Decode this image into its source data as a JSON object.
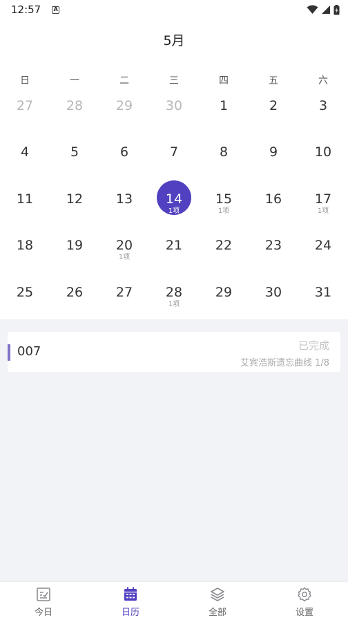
{
  "status_bar": {
    "time": "12:57",
    "a_icon": "A"
  },
  "calendar": {
    "month": "5月",
    "weekdays": [
      "日",
      "一",
      "二",
      "三",
      "四",
      "五",
      "六"
    ],
    "days": [
      {
        "num": "27",
        "muted": true,
        "count": ""
      },
      {
        "num": "28",
        "muted": true,
        "count": ""
      },
      {
        "num": "29",
        "muted": true,
        "count": ""
      },
      {
        "num": "30",
        "muted": true,
        "count": ""
      },
      {
        "num": "1",
        "count": ""
      },
      {
        "num": "2",
        "count": ""
      },
      {
        "num": "3",
        "count": ""
      },
      {
        "num": "4",
        "count": ""
      },
      {
        "num": "5",
        "count": ""
      },
      {
        "num": "6",
        "count": ""
      },
      {
        "num": "7",
        "count": ""
      },
      {
        "num": "8",
        "count": ""
      },
      {
        "num": "9",
        "count": ""
      },
      {
        "num": "10",
        "count": ""
      },
      {
        "num": "11",
        "count": ""
      },
      {
        "num": "12",
        "count": ""
      },
      {
        "num": "13",
        "count": ""
      },
      {
        "num": "14",
        "count": "1项",
        "selected": true
      },
      {
        "num": "15",
        "count": "1项"
      },
      {
        "num": "16",
        "count": ""
      },
      {
        "num": "17",
        "count": "1项"
      },
      {
        "num": "18",
        "count": ""
      },
      {
        "num": "19",
        "count": ""
      },
      {
        "num": "20",
        "count": "1项"
      },
      {
        "num": "21",
        "count": ""
      },
      {
        "num": "22",
        "count": ""
      },
      {
        "num": "23",
        "count": ""
      },
      {
        "num": "24",
        "count": ""
      },
      {
        "num": "25",
        "count": ""
      },
      {
        "num": "26",
        "count": ""
      },
      {
        "num": "27",
        "count": ""
      },
      {
        "num": "28",
        "count": "1项"
      },
      {
        "num": "29",
        "count": ""
      },
      {
        "num": "30",
        "count": ""
      },
      {
        "num": "31",
        "count": ""
      }
    ]
  },
  "task": {
    "title": "007",
    "status": "已完成",
    "curve": "艾宾浩斯遗忘曲线 1/8"
  },
  "nav": {
    "items": [
      {
        "label": "今日",
        "icon": "today-icon"
      },
      {
        "label": "日历",
        "icon": "calendar-icon",
        "active": true
      },
      {
        "label": "全部",
        "icon": "layers-icon"
      },
      {
        "label": "设置",
        "icon": "gear-icon"
      }
    ]
  },
  "colors": {
    "accent": "#5141c0",
    "task_bar": "#7f74c9",
    "background": "#f2f3f7"
  }
}
